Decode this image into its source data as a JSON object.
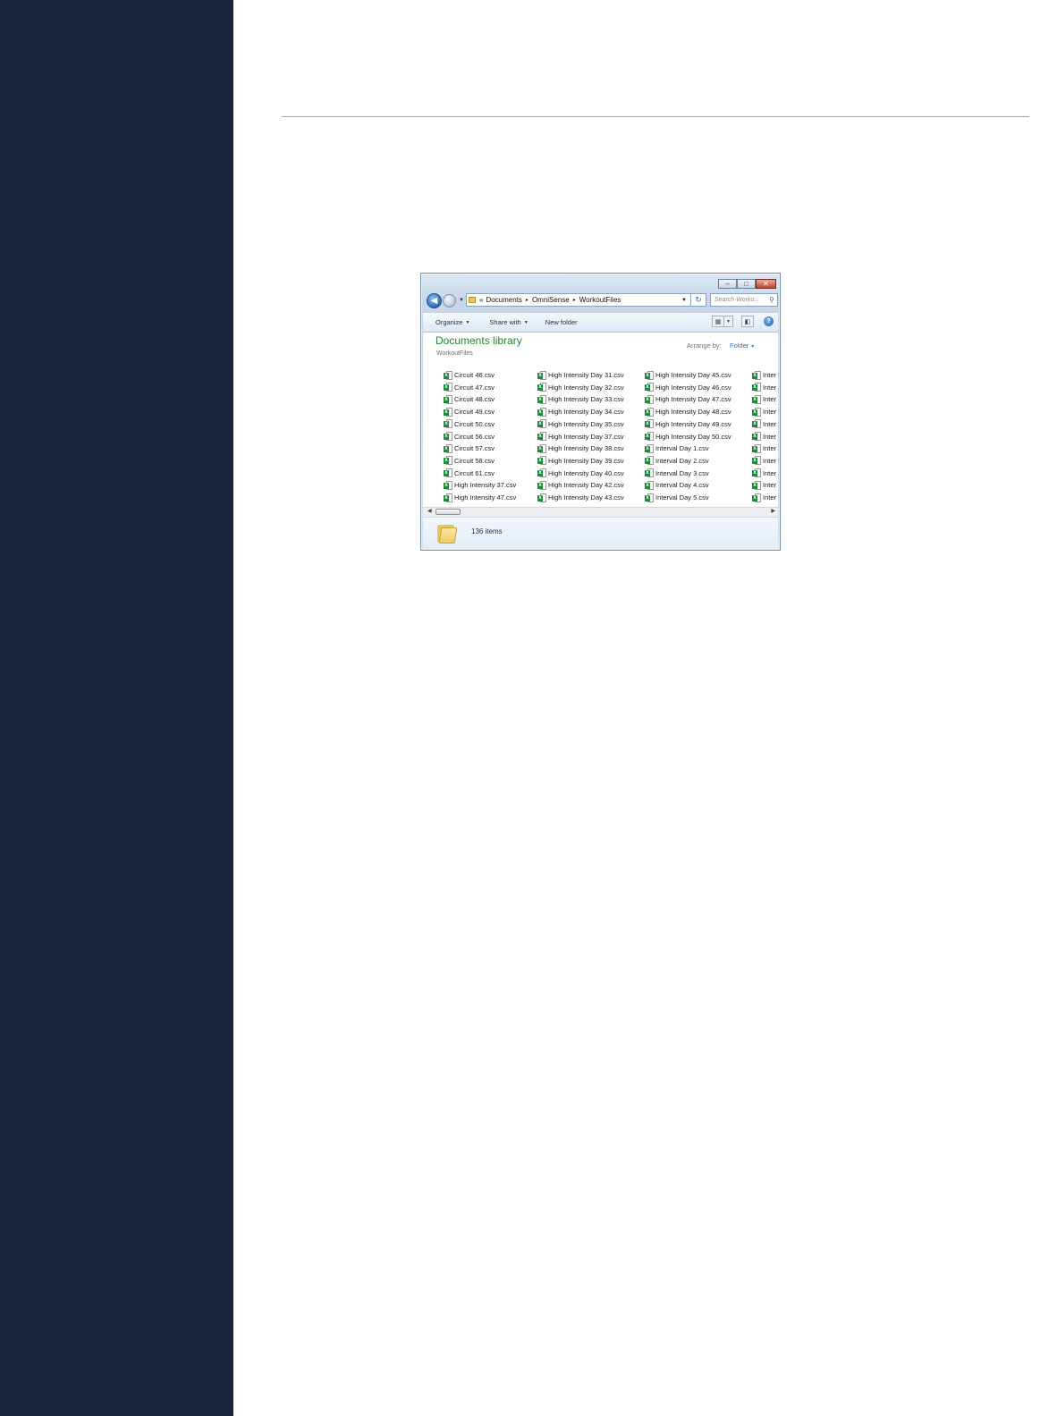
{
  "window": {
    "caption_buttons": [
      "minimize",
      "maximize",
      "close"
    ],
    "address": {
      "prefix": "«",
      "segments": [
        "Documents",
        "OmniSense",
        "WorkoutFiles"
      ],
      "separator": "▸"
    },
    "search_placeholder": "Search Worko...",
    "commands": {
      "organize": "Organize",
      "share_with": "Share with",
      "new_folder": "New folder"
    },
    "library": {
      "title": "Documents library",
      "subtitle": "WorkoutFiles",
      "arrange_label": "Arrange by:",
      "arrange_value": "Folder"
    },
    "columns": [
      [
        "Circuit 46.csv",
        "Circuit 47.csv",
        "Circuit 48.csv",
        "Circuit 49.csv",
        "Circuit 50.csv",
        "Circuit 56.csv",
        "Circuit 57.csv",
        "Circuit 58.csv",
        "Circuit 61.csv",
        "High Intensity 37.csv",
        "High Intensity 47.csv"
      ],
      [
        "High Intensity Day 31.csv",
        "High Intensity Day 32.csv",
        "High Intensity Day 33.csv",
        "High Intensity Day 34.csv",
        "High Intensity Day 35.csv",
        "High Intensity Day 37.csv",
        "High Intensity Day 38.csv",
        "High Intensity Day 39.csv",
        "High Intensity Day 40.csv",
        "High Intensity Day 42.csv",
        "High Intensity Day 43.csv"
      ],
      [
        "High Intensity Day 45.csv",
        "High Intensity Day 46.csv",
        "High Intensity Day 47.csv",
        "High Intensity Day 48.csv",
        "High Intensity Day 49.csv",
        "High Intensity Day 50.csv",
        "Interval Day 1.csv",
        "Interval Day 2.csv",
        "Interval Day 3.csv",
        "Interval Day 4.csv",
        "Interval Day 5.csv"
      ],
      [
        "Inter",
        "Inter",
        "Inter",
        "Inter",
        "Inter",
        "Inter",
        "Inter",
        "Inter",
        "Inter",
        "Inter",
        "Inter"
      ]
    ],
    "status": {
      "item_count": "136 items"
    }
  },
  "colors": {
    "side_panel": "#1b223c",
    "library_title": "#1e8c2c",
    "link_blue": "#2b6cc4"
  },
  "icons": {
    "file": "excel-csv-icon",
    "folder": "folder-icon"
  }
}
